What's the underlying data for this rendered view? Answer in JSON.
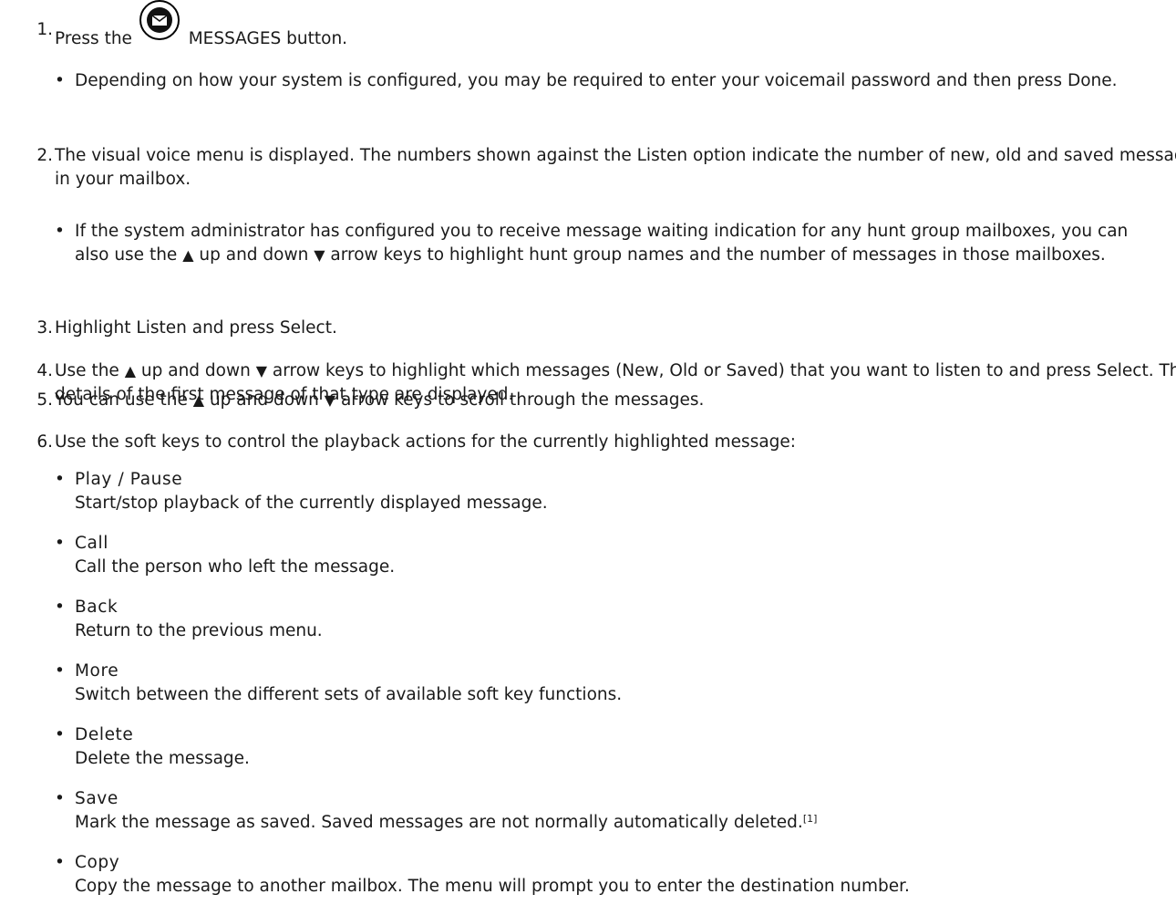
{
  "steps": [
    {
      "n": "1.",
      "before": "Press the ",
      "icon": "envelope-icon",
      "after": "MESSAGES button.",
      "sub": [
        "Depending on how your system is configured, you may be required to enter your voicemail password and then press Done."
      ]
    },
    {
      "n": "2.",
      "text": "The visual voice menu is displayed. The numbers shown against the Listen option indicate the number of new, old and saved messages in your mailbox.",
      "sub_a": "If the system administrator has configured you to receive message waiting indication for any hunt group mailboxes, you can also use the ",
      "sub_b": " up and down ",
      "sub_c": " arrow keys to highlight hunt group names and the number of messages in those mailboxes."
    },
    {
      "n": "3.",
      "text": "Highlight Listen and press Select."
    },
    {
      "n": "4.",
      "a": "Use the ",
      "b": " up and down ",
      "c": " arrow keys to highlight which messages (New, Old or Saved) that you want to listen to and press Select. The details of the first message of that type are displayed."
    },
    {
      "n": "5.",
      "a": "You can use the ",
      "b": " up and down ",
      "c": " arrow keys to scroll through the messages."
    },
    {
      "n": "6.",
      "text": "Use the soft keys to control the playback actions for the currently highlighted message:"
    }
  ],
  "softkeys": [
    {
      "name": "Play / Pause",
      "desc": "Start/stop playback of the currently displayed message."
    },
    {
      "name": "Call",
      "desc": "Call the person who left the message."
    },
    {
      "name": "Back",
      "desc": "Return to the previous menu."
    },
    {
      "name": "More",
      "desc": "Switch between the different sets of available soft key functions."
    },
    {
      "name": "Delete",
      "desc": "Delete the message."
    },
    {
      "name": "Save",
      "desc": "Mark the message as saved. Saved messages are not normally automatically deleted.",
      "footnote": "[1]"
    },
    {
      "name": "Copy",
      "desc": "Copy the message to another mailbox. The menu will prompt you to enter the destination number."
    }
  ],
  "glyphs": {
    "bullet": "•",
    "up": "▲",
    "down": "▼"
  }
}
